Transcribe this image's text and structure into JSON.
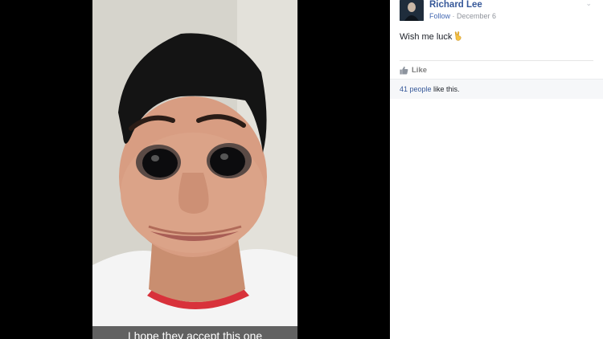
{
  "photo": {
    "caption": "I hope they accept this one"
  },
  "post": {
    "author_name": "Richard Lee",
    "follow_label": "Follow",
    "separator": " · ",
    "date": "December 6",
    "text": "Wish me luck",
    "emoji": "victory-hand"
  },
  "actions": {
    "like_label": "Like"
  },
  "likes_summary": {
    "count_text": "41 people",
    "suffix": " like this."
  },
  "colors": {
    "link": "#365899",
    "meta": "#90949c",
    "follow": "#4267b2"
  }
}
